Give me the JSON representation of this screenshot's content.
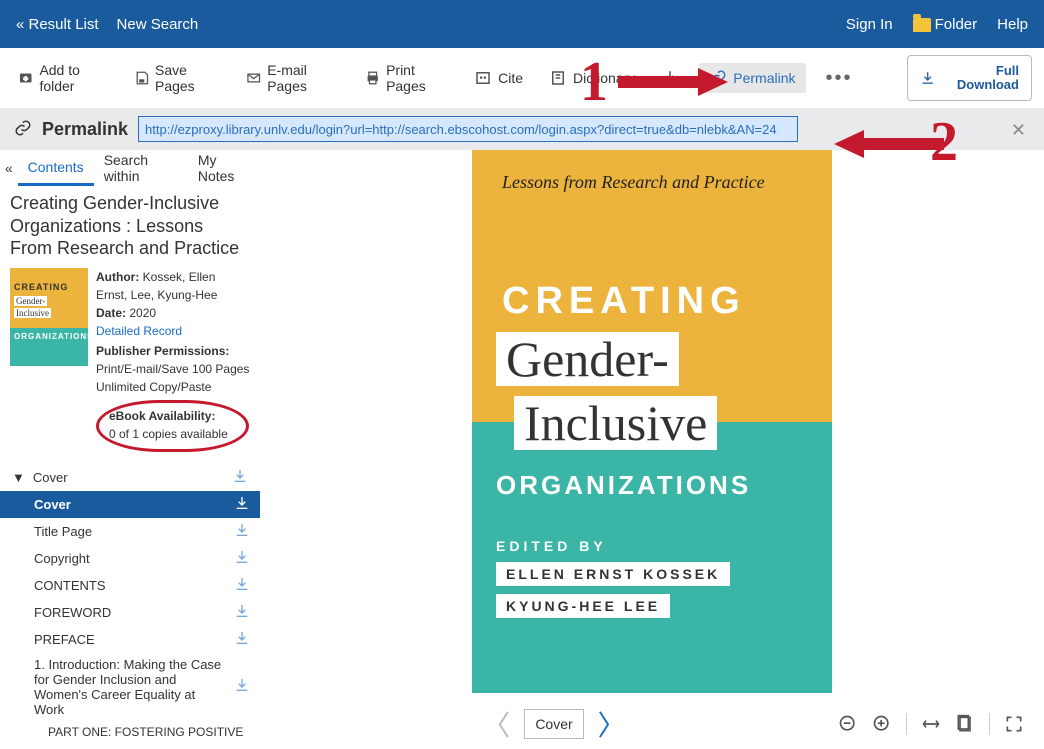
{
  "topbar": {
    "result_list": "« Result List",
    "new_search": "New Search",
    "sign_in": "Sign In",
    "folder": "Folder",
    "help": "Help"
  },
  "toolbar": {
    "add_folder": "Add to folder",
    "save_pages": "Save Pages",
    "email_pages": "E-mail Pages",
    "print_pages": "Print Pages",
    "cite": "Cite",
    "dictionary": "Dictionary",
    "permalink": "Permalink",
    "full_download": "Full Download"
  },
  "permabar": {
    "label": "Permalink",
    "url": "http://ezproxy.library.unlv.edu/login?url=http://search.ebscohost.com/login.aspx?direct=true&db=nlebk&AN=24"
  },
  "tabs": {
    "contents": "Contents",
    "search_within": "Search within",
    "my_notes": "My Notes"
  },
  "record": {
    "title": "Creating Gender-Inclusive Organizations : Lessons From Research and Practice",
    "author_label": "Author:",
    "author": "Kossek, Ellen Ernst, Lee, Kyung-Hee",
    "date_label": "Date:",
    "date": "2020",
    "detailed_record": "Detailed Record",
    "pub_perm_label": "Publisher Permissions:",
    "pub_perm_1": "Print/E-mail/Save 100 Pages",
    "pub_perm_2": "Unlimited Copy/Paste",
    "avail_label": "eBook Availability:",
    "avail_value": "0 of 1 copies available"
  },
  "toc": {
    "cover_head": "Cover",
    "items": [
      {
        "label": "Cover"
      },
      {
        "label": "Title Page"
      },
      {
        "label": "Copyright"
      },
      {
        "label": "CONTENTS"
      },
      {
        "label": "FOREWORD"
      },
      {
        "label": "PREFACE"
      },
      {
        "label": "1. Introduction: Making the Case for Gender Inclusion and Women's Career Equality at Work"
      }
    ],
    "sub": "PART ONE: FOSTERING POSITIVE"
  },
  "cover": {
    "lessons": "Lessons from Research and Practice",
    "creating": "CREATING",
    "gender": "Gender-",
    "inclusive": "Inclusive",
    "organizations": "ORGANIZATIONS",
    "edited_by": "EDITED BY",
    "editor1": "ELLEN ERNST KOSSEK",
    "editor2": "KYUNG-HEE LEE"
  },
  "viewer_controls": {
    "page_label": "Cover"
  },
  "annotations": {
    "n1": "1",
    "n2": "2"
  }
}
